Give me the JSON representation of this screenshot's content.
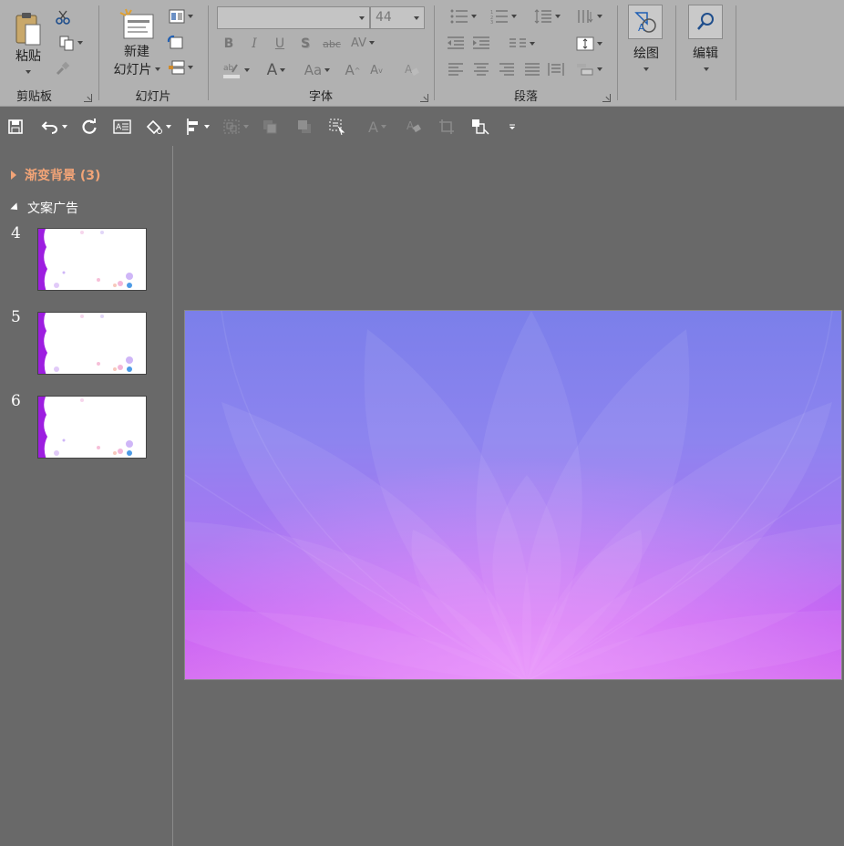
{
  "ribbon": {
    "clipboard": {
      "label": "剪贴板",
      "paste": "粘贴"
    },
    "slides": {
      "label": "幻灯片",
      "new_line1": "新建",
      "new_line2": "幻灯片"
    },
    "font": {
      "label": "字体",
      "font_name": "",
      "font_size": "44",
      "bold": "B",
      "italic": "I",
      "underline": "U",
      "shadow": "S",
      "strike": "abc",
      "spacing": "AV",
      "color": "A",
      "case": "Aa",
      "grow": "A",
      "shrink": "A"
    },
    "paragraph": {
      "label": "段落"
    },
    "drawing": {
      "label": "绘图"
    },
    "editing": {
      "label": "编辑"
    }
  },
  "slide_pane": {
    "sections": [
      {
        "title": "渐变背景 (3)",
        "collapsed": true,
        "color": "#f2a477"
      },
      {
        "title": "文案广告",
        "collapsed": false,
        "color": "#ffffff"
      }
    ],
    "thumbnails": [
      {
        "number": "4"
      },
      {
        "number": "5"
      },
      {
        "number": "6"
      }
    ]
  },
  "colors": {
    "ribbon_bg": "#b1b1b1",
    "workspace_bg": "#696969",
    "slide_top": "#7b7fea",
    "slide_bottom": "#d36cf0"
  }
}
